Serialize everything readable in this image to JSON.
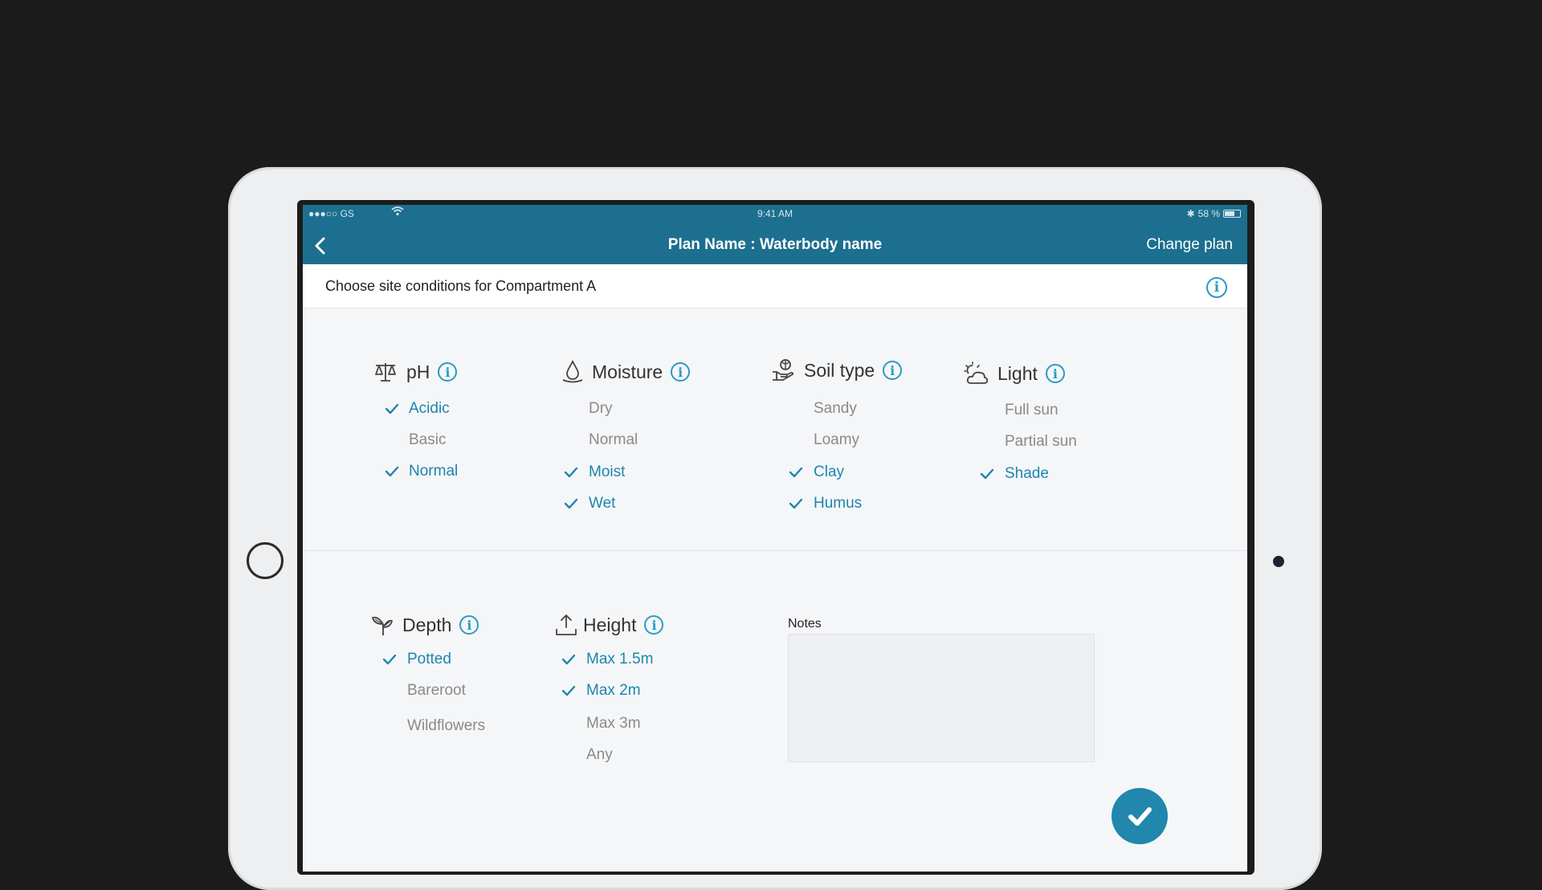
{
  "colors": {
    "accent": "#1c6f8e",
    "selected": "#1c86ad",
    "unselected": "#8a8a8a",
    "fab": "#2187ad"
  },
  "status_bar": {
    "carrier": "●●●○○ GS",
    "time": "9:41 AM",
    "battery": "58 %"
  },
  "nav": {
    "title": "Plan Name : Waterbody name",
    "action": "Change plan",
    "back_icon": "chevron-left-icon"
  },
  "subheader": {
    "text": "Choose site conditions for Compartment A",
    "info_glyph": "i"
  },
  "info_glyph": "i",
  "groups": {
    "ph": {
      "title": "pH",
      "icon": "scale-icon",
      "options": [
        {
          "label": "Acidic",
          "selected": true
        },
        {
          "label": "Basic",
          "selected": false
        },
        {
          "label": "Normal",
          "selected": true
        }
      ]
    },
    "moisture": {
      "title": "Moisture",
      "icon": "water-drop-icon",
      "options": [
        {
          "label": "Dry",
          "selected": false
        },
        {
          "label": "Normal",
          "selected": false
        },
        {
          "label": "Moist",
          "selected": true
        },
        {
          "label": "Wet",
          "selected": true
        }
      ]
    },
    "soil": {
      "title": "Soil type",
      "icon": "soil-hand-icon",
      "options": [
        {
          "label": "Sandy",
          "selected": false
        },
        {
          "label": "Loamy",
          "selected": false
        },
        {
          "label": "Clay",
          "selected": true
        },
        {
          "label": "Humus",
          "selected": true
        }
      ]
    },
    "light": {
      "title": "Light",
      "icon": "sun-cloud-icon",
      "options": [
        {
          "label": "Full sun",
          "selected": false
        },
        {
          "label": "Partial sun",
          "selected": false
        },
        {
          "label": "Shade",
          "selected": true
        }
      ]
    },
    "depth": {
      "title": "Depth",
      "icon": "plant-icon",
      "options": [
        {
          "label": "Potted",
          "selected": true
        },
        {
          "label": "Bareroot",
          "selected": false
        },
        {
          "label": "Wildflowers",
          "selected": false
        }
      ]
    },
    "height": {
      "title": "Height",
      "icon": "height-upload-icon",
      "options": [
        {
          "label": "Max 1.5m",
          "selected": true
        },
        {
          "label": "Max 2m",
          "selected": true
        },
        {
          "label": "Max 3m",
          "selected": false
        },
        {
          "label": "Any",
          "selected": false
        }
      ]
    }
  },
  "notes": {
    "label": "Notes",
    "value": ""
  },
  "confirm_icon": "checkmark-icon"
}
